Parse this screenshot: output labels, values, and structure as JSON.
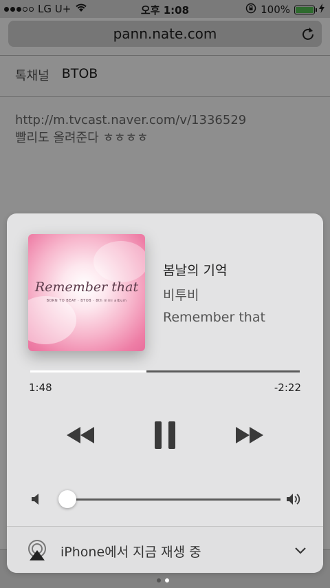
{
  "status_bar": {
    "carrier": "LG U+",
    "time": "오후 1:08",
    "battery": "100%"
  },
  "browser": {
    "url": "pann.nate.com",
    "reload_icon": "reload-icon"
  },
  "post": {
    "meta_label": "톡채널",
    "meta_value": "BTOB",
    "link": "http://m.tvcast.naver.com/v/1336529",
    "comment": "빨리도 올려준다 ㅎㅎㅎㅎ"
  },
  "now_playing": {
    "album_art_title": "Remember that",
    "album_art_subtitle": "BORN TO BEAT · BTOB · 8th mini album",
    "title": "봄날의 기억",
    "artist": "비투비",
    "album": "Remember that",
    "elapsed": "1:48",
    "remaining": "-2:22",
    "progress": 0.43,
    "volume": 0.03
  },
  "airplay": {
    "label": "iPhone에서 지금 재생 중"
  },
  "colors": {
    "card_bg": "#e3e3e4",
    "track_color": "#5b5b5b",
    "fill_color": "#ffffff",
    "art_pink": "#ee7ea6"
  }
}
